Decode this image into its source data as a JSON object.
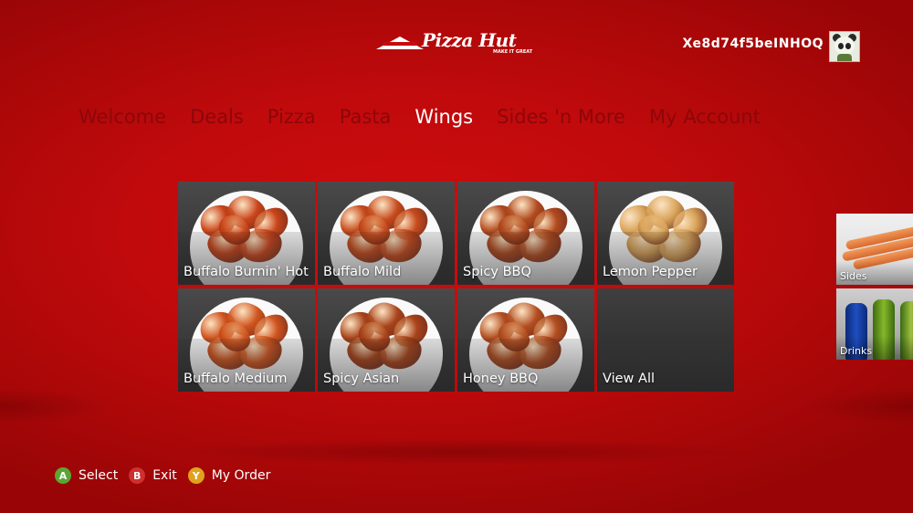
{
  "brand": {
    "logo_text": "Pizza Hut",
    "logo_tagline": "MAKE IT GREAT"
  },
  "user": {
    "gamertag": "Xe8d74f5beINHOQ",
    "avatar_icon": "panda-avatar-icon"
  },
  "nav": {
    "items": [
      {
        "label": "Welcome",
        "active": false
      },
      {
        "label": "Deals",
        "active": false
      },
      {
        "label": "Pizza",
        "active": false
      },
      {
        "label": "Pasta",
        "active": false
      },
      {
        "label": "Wings",
        "active": true
      },
      {
        "label": "Sides 'n More",
        "active": false
      },
      {
        "label": "My Account",
        "active": false
      }
    ]
  },
  "wings": {
    "tiles": [
      {
        "label": "Buffalo Burnin' Hot",
        "sauce_color": "#c9441a"
      },
      {
        "label": "Buffalo Mild",
        "sauce_color": "#c64a1c"
      },
      {
        "label": "Spicy BBQ",
        "sauce_color": "#b14a1e"
      },
      {
        "label": "Lemon Pepper",
        "sauce_color": "#d9a45a"
      },
      {
        "label": "Buffalo Medium",
        "sauce_color": "#d0541e"
      },
      {
        "label": "Spicy Asian",
        "sauce_color": "#a8431a"
      },
      {
        "label": "Honey BBQ",
        "sauce_color": "#b24d20"
      },
      {
        "label": "View All",
        "sauce_color": ""
      }
    ]
  },
  "side_previews": [
    {
      "label": "Sides"
    },
    {
      "label": "Drinks"
    }
  ],
  "button_hints": [
    {
      "key": "A",
      "label": "Select",
      "color": "#5aa634"
    },
    {
      "key": "B",
      "label": "Exit",
      "color": "#cf2f2f"
    },
    {
      "key": "Y",
      "label": "My Order",
      "color": "#e0a21c"
    }
  ],
  "colors": {
    "background": "#c00a0c",
    "nav_inactive": "#8c0709",
    "nav_active": "#ffffff",
    "tile": "#3c3c3c"
  }
}
